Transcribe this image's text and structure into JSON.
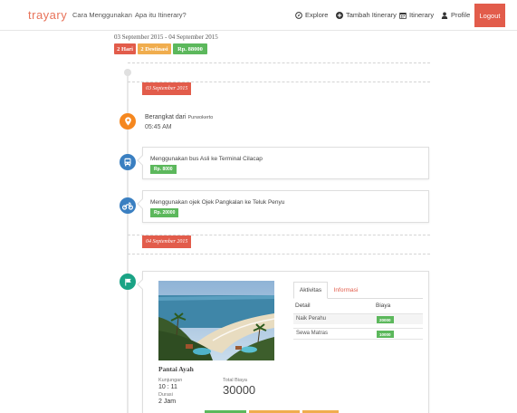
{
  "nav": {
    "brand": "trayary",
    "links": [
      "Cara Menggunakan",
      "Apa itu Itinerary?"
    ],
    "explore": "Explore",
    "tambah": "Tambah Itinerary",
    "itinerary": "Itinerary",
    "profile": "Profile",
    "logout": "Logout"
  },
  "header": {
    "date_range": "03 September 2015 - 04 September 2015",
    "badges": [
      "2 Hari",
      "2 Destinasi",
      "Rp. 88000"
    ]
  },
  "colors": {
    "red": "#e25c4b",
    "orange": "#f0ad4e",
    "green": "#5cb85c",
    "blue": "#3a7fc1",
    "teal": "#1aa385",
    "marker": "#f5871f"
  },
  "day1": {
    "date": "03 September 2015",
    "departure": {
      "prefix": "Berangkat",
      "mid": "dari",
      "place": "Purwokerto",
      "time": "05:45 AM",
      "icon": "map-marker-icon"
    },
    "transport": [
      {
        "icon": "bus-icon",
        "text": "Menggunakan bus Asli ke Terminal Cilacap",
        "price": "Rp. 8000"
      },
      {
        "icon": "motorcycle-icon",
        "text": "Menggunakan ojek Ojek Pangkalan ke Teluk Penyu",
        "price": "Rp. 20000"
      }
    ]
  },
  "day2": {
    "date": "04 September 2015",
    "destination": {
      "icon": "flag-icon",
      "name": "Pantai Ayah",
      "kunjungan_label": "Kunjungan",
      "kunjungan": "10 : 11",
      "durasi_label": "Durasi",
      "durasi": "2 Jam",
      "total_label": "Total Biaya",
      "total": "30000",
      "tabs": [
        "Aktivitas",
        "Informasi"
      ],
      "table_headers": [
        "Detail",
        "Biaya"
      ],
      "rows": [
        {
          "detail": "Naik Perahu",
          "biaya": "20000"
        },
        {
          "detail": "Sewa Matras",
          "biaya": "10000"
        }
      ]
    }
  }
}
